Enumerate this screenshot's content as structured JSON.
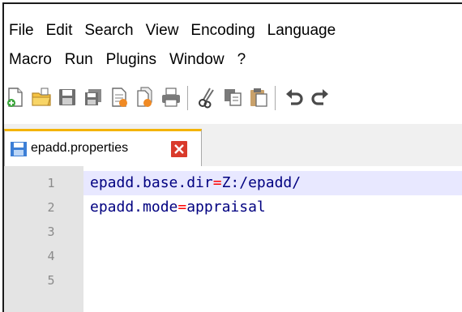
{
  "menu": {
    "row1": [
      "File",
      "Edit",
      "Search",
      "View",
      "Encoding",
      "Language"
    ],
    "row2": [
      "Macro",
      "Run",
      "Plugins",
      "Window",
      "?"
    ]
  },
  "toolbar": {
    "icons": [
      "new-file-icon",
      "open-file-icon",
      "save-icon",
      "save-all-icon",
      "close-icon",
      "close-all-icon",
      "print-icon",
      "cut-icon",
      "copy-icon",
      "paste-icon",
      "undo-icon",
      "redo-icon"
    ]
  },
  "tabs": [
    {
      "label": "epadd.properties"
    }
  ],
  "editor": {
    "line_numbers": [
      "1",
      "2",
      "3",
      "4",
      "5"
    ],
    "lines": [
      {
        "key": "epadd.base.dir",
        "eq": "=",
        "value": "Z:/epadd/"
      },
      {
        "key": "epadd.mode",
        "eq": "=",
        "value": "appraisal"
      }
    ],
    "colors": {
      "key": "#000080",
      "operator": "#ff0000",
      "current_line": "#e8e8ff",
      "gutter": "#e4e4e4"
    }
  }
}
